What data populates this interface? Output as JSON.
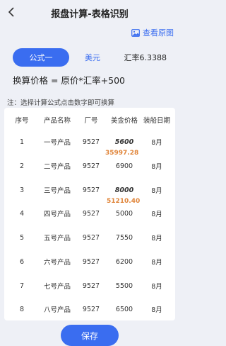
{
  "header": {
    "title": "报盘计算-表格识别"
  },
  "view_original": "查看原图",
  "formula_bar": {
    "formula_button": "公式一",
    "currency_button": "美元",
    "rate_label": "汇率6.3388"
  },
  "formula_text": "换算价格 = 原价*汇率+500",
  "note": "注：选择计算公式点击数字即可换算",
  "table": {
    "columns": [
      "序号",
      "产品名称",
      "厂号",
      "美金价格",
      "装船日期"
    ],
    "rows": [
      {
        "no": "1",
        "name": "一号产品",
        "factory": "9527",
        "price": "5600",
        "converted": "35997.28",
        "date": "8月"
      },
      {
        "no": "2",
        "name": "二号产品",
        "factory": "9527",
        "price": "6900",
        "converted": "",
        "date": "8月"
      },
      {
        "no": "3",
        "name": "三号产品",
        "factory": "9527",
        "price": "8000",
        "converted": "51210.40",
        "date": "8月"
      },
      {
        "no": "4",
        "name": "四号产品",
        "factory": "9527",
        "price": "5000",
        "converted": "",
        "date": "8月"
      },
      {
        "no": "5",
        "name": "五号产品",
        "factory": "9527",
        "price": "7550",
        "converted": "",
        "date": "8月"
      },
      {
        "no": "6",
        "name": "六号产品",
        "factory": "9527",
        "price": "6200",
        "converted": "",
        "date": "8月"
      },
      {
        "no": "7",
        "name": "七号产品",
        "factory": "9527",
        "price": "5500",
        "converted": "",
        "date": "8月"
      },
      {
        "no": "8",
        "name": "八号产品",
        "factory": "9527",
        "price": "6500",
        "converted": "",
        "date": "8月"
      }
    ]
  },
  "save_button": "保存",
  "colors": {
    "accent": "#3a6df0",
    "converted": "#e0853a",
    "background": "#eef0f6"
  }
}
